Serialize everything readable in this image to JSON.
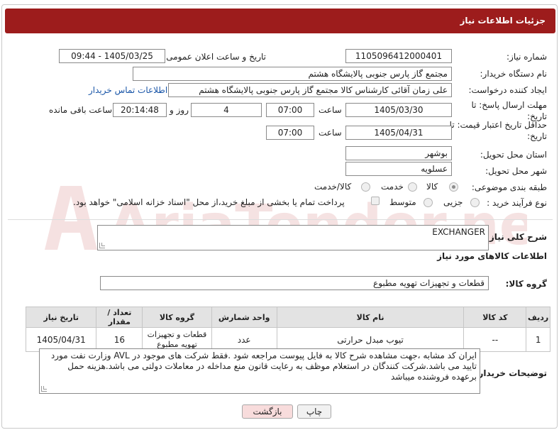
{
  "header": {
    "title": "جزئیات اطلاعات نیاز"
  },
  "form": {
    "need_number": {
      "label": "شماره نیاز:",
      "value": "1105096412000401"
    },
    "announce_datetime": {
      "label": "تاریخ و ساعت اعلان عمومی:",
      "value": "1405/03/25 - 09:44"
    },
    "buyer_org": {
      "label": "نام دستگاه خریدار:",
      "value": "مجتمع گاز پارس جنوبی  پالایشگاه هشتم"
    },
    "requester": {
      "label": "ایجاد کننده درخواست:",
      "value": "علی زمان آقائی کارشناس کالا مجتمع گاز پارس جنوبی  پالایشگاه هشتم",
      "contact_link": "اطلاعات تماس خریدار"
    },
    "reply_deadline": {
      "label": "مهلت ارسال پاسخ: تا تاریخ:",
      "date": "1405/03/30",
      "time_label": "ساعت",
      "time": "07:00",
      "days": "4",
      "days_label": "روز و",
      "remaining": "20:14:48",
      "remaining_label": "ساعت باقی مانده"
    },
    "price_validity": {
      "label": "حداقل تاریخ اعتبار قیمت: تا تاریخ:",
      "date": "1405/04/31",
      "time_label": "ساعت",
      "time": "07:00"
    },
    "province": {
      "label": "استان محل تحویل:",
      "value": "بوشهر"
    },
    "city": {
      "label": "شهر محل تحویل:",
      "value": "عسلویه"
    },
    "category": {
      "label": "طبقه بندی موضوعی:",
      "options": [
        "کالا",
        "خدمت",
        "کالا/خدمت"
      ],
      "selected": "کالا"
    },
    "process_type": {
      "label": "نوع فرآیند خرید :",
      "options": [
        "جزیی",
        "متوسط"
      ],
      "payment_note": "پرداخت تمام یا بخشی از مبلغ خرید،از محل \"اسناد خزانه اسلامی\" خواهد بود."
    }
  },
  "summary": {
    "label": "شرح کلی نیاز:",
    "value": "EXCHANGER"
  },
  "goods_section": {
    "title": "اطلاعات کالاهای مورد نیاز",
    "group_label": "گروه کالا:",
    "group_value": "قطعات و تجهیزات تهویه مطبوع"
  },
  "table": {
    "headers": [
      "ردیف",
      "کد کالا",
      "نام کالا",
      "واحد شمارش",
      "گروه کالا",
      "تعداد / مقدار",
      "تاریخ نیاز"
    ],
    "rows": [
      {
        "row": "1",
        "code": "--",
        "name": "تیوب مبدل حرارتی",
        "unit": "عدد",
        "group": "قطعات و تجهیزات تهویه مطبوع",
        "qty": "16",
        "date": "1405/04/31"
      }
    ]
  },
  "buyer_notes": {
    "label": "توضیحات خریدار:",
    "value": "ایران کد مشابه ،جهت مشاهده شرح کالا به فایل پیوست مراجعه شود .فقط شرکت های موجود در AVL وزارت نفت مورد تایید می باشد.شرکت کنندگان در استعلام موظف به رعایت قانون منع مداخله در معاملات دولتی می باشد.هزینه حمل برعهده فروشنده میباشد"
  },
  "buttons": {
    "print": "چاپ",
    "back": "بازگشت"
  },
  "watermark": {
    "text": "AriaTender.neT"
  },
  "colors": {
    "header_bg": "#9d1c1c",
    "link": "#1a56a8",
    "back_button_bg": "#f8dcdc"
  }
}
